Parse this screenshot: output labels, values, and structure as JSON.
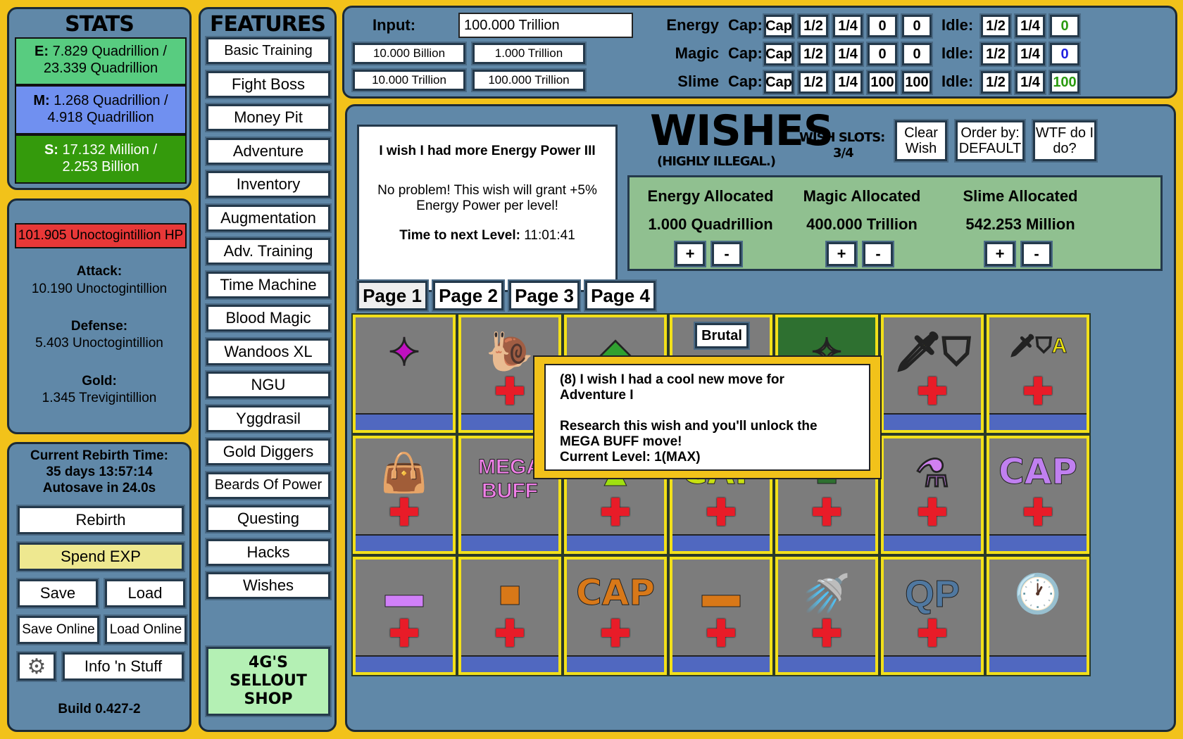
{
  "colors": {
    "background": "#6088a8",
    "frame": "#f2c21a",
    "energy": "#58cc80",
    "magic": "#7090f0",
    "slime": "#349a0c",
    "hp": "#e83838",
    "spend_exp": "#eee890",
    "shop": "#b4f0b4",
    "allocation": "#90c090"
  },
  "stats": {
    "title": "STATS",
    "energy": {
      "label": "E:",
      "value": "7.829 Quadrillion /",
      "cap": "23.339 Quadrillion"
    },
    "magic": {
      "label": "M:",
      "value": "1.268 Quadrillion /",
      "cap": "4.918 Quadrillion"
    },
    "slime": {
      "label": "S:",
      "value": "17.132 Million /",
      "cap": "2.253 Billion"
    }
  },
  "combat": {
    "hp": "101.905 Unoctogintillion HP",
    "attack_label": "Attack:",
    "attack": "10.190 Unoctogintillion",
    "defense_label": "Defense:",
    "defense": "5.403 Unoctogintillion",
    "gold_label": "Gold:",
    "gold": "1.345 Trevigintillion"
  },
  "rebirth": {
    "time_label": "Current Rebirth Time:",
    "time": "35 days 13:57:14",
    "autosave": "Autosave in 24.0s",
    "rebirth": "Rebirth",
    "spend_exp": "Spend EXP",
    "save": "Save",
    "load": "Load",
    "save_online": "Save Online",
    "load_online": "Load Online",
    "info": "Info 'n Stuff",
    "build": "Build 0.427-2",
    "settings_icon": "gear-icon"
  },
  "features": {
    "title": "FEATURES",
    "items": [
      "Basic Training",
      "Fight Boss",
      "Money Pit",
      "Adventure",
      "Inventory",
      "Augmentation",
      "Adv. Training",
      "Time Machine",
      "Blood Magic",
      "Wandoos XL",
      "NGU",
      "Yggdrasil",
      "Gold Diggers",
      "Beards Of Power",
      "Questing",
      "Hacks",
      "Wishes"
    ],
    "shop": "4G'S SELLOUT SHOP"
  },
  "input": {
    "label": "Input:",
    "value": "100.000 Trillion",
    "presets": [
      "10.000 Billion",
      "1.000 Trillion",
      "10.000 Trillion",
      "100.000 Trillion"
    ]
  },
  "caps": {
    "cap_label": "Cap:",
    "idle_label": "Idle:",
    "rows": [
      {
        "name": "Energy",
        "buttons": [
          "Cap",
          "1/2",
          "1/4",
          "0",
          "0"
        ],
        "idle": [
          "1/2",
          "1/4",
          "0"
        ],
        "idle_color": "#2a9a10"
      },
      {
        "name": "Magic",
        "buttons": [
          "Cap",
          "1/2",
          "1/4",
          "0",
          "0"
        ],
        "idle": [
          "1/2",
          "1/4",
          "0"
        ],
        "idle_color": "#2020e0"
      },
      {
        "name": "Slime",
        "buttons": [
          "Cap",
          "1/2",
          "1/4",
          "100",
          "100"
        ],
        "idle": [
          "1/2",
          "1/4",
          "100"
        ],
        "idle_color": "#2a9a10"
      }
    ]
  },
  "wishes": {
    "title": "WISHES",
    "subtitle": "(HIGHLY ILLEGAL.)",
    "slots_label": "WISH SLOTS:",
    "slots": "3/4",
    "clear": "Clear Wish",
    "order": "Order by:",
    "order_value": "DEFAULT",
    "help": "WTF do I do?",
    "selected": {
      "name": "I wish I had more Energy Power III",
      "desc": "No problem! This wish will grant +5% Energy Power per level!",
      "time_label": "Time to next Level:",
      "time": "11:01:41"
    },
    "allocation": [
      {
        "label": "Energy Allocated",
        "value": "1.000 Quadrillion"
      },
      {
        "label": "Magic Allocated",
        "value": "400.000 Trillion"
      },
      {
        "label": "Slime Allocated",
        "value": "542.253 Million"
      }
    ],
    "plus": "+",
    "minus": "-",
    "pages": [
      "Page 1",
      "Page 2",
      "Page 3",
      "Page 4"
    ],
    "active_page": 1,
    "items": [
      {
        "icon": "magic-wand-icon",
        "glyph": "✦",
        "color": "#c010c0"
      },
      {
        "icon": "snail-icon",
        "glyph": "🐌",
        "color": "#30a020"
      },
      {
        "icon": "green-gem-icon",
        "glyph": "◆",
        "color": "#30a030"
      },
      {
        "icon": "brutal-icon",
        "label": "Brutal",
        "color": "#000"
      },
      {
        "icon": "green-sparkle-icon",
        "glyph": "✧",
        "color": "#d8c890",
        "bg": "#2e7030"
      },
      {
        "icon": "sword-shield-icon",
        "glyph": "🗡⛉",
        "color": "#c8e010"
      },
      {
        "icon": "sword-shield-a-icon",
        "glyph": "🗡⛉A",
        "color": "#e8e010"
      },
      {
        "icon": "bag-icon",
        "glyph": "👜",
        "color": "#a06040"
      },
      {
        "icon": "mega-buff-icon",
        "glyph": "MEGA BUFF",
        "color": "#f080e8"
      },
      {
        "icon": "green-item-icon",
        "glyph": "▲",
        "color": "#a0e010"
      },
      {
        "icon": "cap-yellow-icon",
        "glyph": "CAP",
        "color": "#c8e010"
      },
      {
        "icon": "green-block-icon",
        "glyph": "■",
        "color": "#2e7030"
      },
      {
        "icon": "potion-icon",
        "glyph": "⚗",
        "color": "#d080f0"
      },
      {
        "icon": "cap-purple-icon",
        "glyph": "CAP",
        "color": "#c080f0"
      },
      {
        "icon": "purple-bar-icon",
        "glyph": "▬",
        "color": "#d080f8"
      },
      {
        "icon": "box-icon",
        "glyph": "■",
        "color": "#d87818"
      },
      {
        "icon": "cap-orange-icon",
        "glyph": "CAP",
        "color": "#d87818"
      },
      {
        "icon": "orange-bar-icon",
        "glyph": "▬",
        "color": "#d87818"
      },
      {
        "icon": "shower-icon",
        "glyph": "🚿",
        "color": "#a8b8b8"
      },
      {
        "icon": "qp-icon",
        "glyph": "QP",
        "color": "#5078a0"
      },
      {
        "icon": "clock-icon",
        "glyph": "🕐",
        "color": "#fff"
      }
    ]
  },
  "tooltip": {
    "title": "(8) I wish I had a cool new move for Adventure I",
    "body": "Research this wish and you'll unlock the MEGA BUFF move!",
    "level": "Current Level: 1(MAX)"
  }
}
